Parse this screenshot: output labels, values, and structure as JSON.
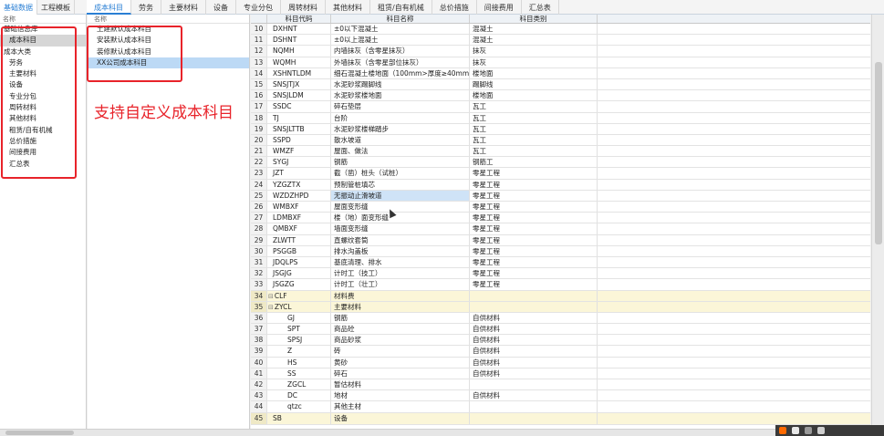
{
  "top_left_tabs": [
    {
      "label": "基础数据",
      "active": true
    },
    {
      "label": "工程模板",
      "active": false
    }
  ],
  "top_main_tabs": [
    {
      "label": "成本科目",
      "active": true
    },
    {
      "label": "劳务",
      "active": false
    },
    {
      "label": "主要材料",
      "active": false
    },
    {
      "label": "设备",
      "active": false
    },
    {
      "label": "专业分包",
      "active": false
    },
    {
      "label": "周转材料",
      "active": false
    },
    {
      "label": "其他材料",
      "active": false
    },
    {
      "label": "租赁/自有机械",
      "active": false
    },
    {
      "label": "总价措施",
      "active": false
    },
    {
      "label": "间接费用",
      "active": false
    },
    {
      "label": "汇总表",
      "active": false
    }
  ],
  "left_panel": {
    "header": "名称",
    "items": [
      {
        "label": "基础信息库",
        "level": 0,
        "selected": false
      },
      {
        "label": "成本科目",
        "level": 1,
        "selected": true
      },
      {
        "label": "成本大类",
        "level": 0,
        "selected": false
      },
      {
        "label": "劳务",
        "level": 1,
        "selected": false
      },
      {
        "label": "主要材料",
        "level": 1,
        "selected": false
      },
      {
        "label": "设备",
        "level": 1,
        "selected": false
      },
      {
        "label": "专业分包",
        "level": 1,
        "selected": false
      },
      {
        "label": "周转材料",
        "level": 1,
        "selected": false
      },
      {
        "label": "其他材料",
        "level": 1,
        "selected": false
      },
      {
        "label": "租赁/自有机械",
        "level": 1,
        "selected": false
      },
      {
        "label": "总价措施",
        "level": 1,
        "selected": false
      },
      {
        "label": "间接费用",
        "level": 1,
        "selected": false
      },
      {
        "label": "汇总表",
        "level": 1,
        "selected": false
      }
    ]
  },
  "mid_panel": {
    "header": "名称",
    "items": [
      {
        "label": "土建默认成本科目",
        "selected": false
      },
      {
        "label": "安装默认成本科目",
        "selected": false
      },
      {
        "label": "装修默认成本科目",
        "selected": false
      },
      {
        "label": "XX公司成本科目",
        "selected": true
      }
    ]
  },
  "annotation": "支持自定义成本科目",
  "table": {
    "columns": [
      "科目代码",
      "科目名称",
      "科目类别"
    ],
    "rows": [
      {
        "num": "10",
        "code": "DXHNT",
        "name": "±0以下混凝土",
        "cat": "混凝土"
      },
      {
        "num": "11",
        "code": "DSHNT",
        "name": "±0以上混凝土",
        "cat": "混凝土"
      },
      {
        "num": "12",
        "code": "NQMH",
        "name": "内墙抹灰（含零星抹灰）",
        "cat": "抹灰"
      },
      {
        "num": "13",
        "code": "WQMH",
        "name": "外墙抹灰（含零星部位抹灰）",
        "cat": "抹灰"
      },
      {
        "num": "14",
        "code": "XSHNTLDM",
        "name": "细石混凝土楼地面（100mm>厚度≥40mm",
        "cat": "楼地面"
      },
      {
        "num": "15",
        "code": "SNSJTJX",
        "name": "水泥砂浆踢脚线",
        "cat": "踢脚线"
      },
      {
        "num": "16",
        "code": "SNSJLDM",
        "name": "水泥砂浆楼地面",
        "cat": "楼地面"
      },
      {
        "num": "17",
        "code": "SSDC",
        "name": "碎石垫层",
        "cat": "瓦工"
      },
      {
        "num": "18",
        "code": "TJ",
        "name": "台阶",
        "cat": "瓦工"
      },
      {
        "num": "19",
        "code": "SNSJLTTB",
        "name": "水泥砂浆楼梯踏步",
        "cat": "瓦工"
      },
      {
        "num": "20",
        "code": "SSPD",
        "name": "散水坡道",
        "cat": "瓦工"
      },
      {
        "num": "21",
        "code": "WMZF",
        "name": "屋面、做法",
        "cat": "瓦工"
      },
      {
        "num": "22",
        "code": "SYGJ",
        "name": "钢筋",
        "cat": "钢筋工"
      },
      {
        "num": "23",
        "code": "JZT",
        "name": "截（凿）桩头（试桩）",
        "cat": "零星工程"
      },
      {
        "num": "24",
        "code": "YZGZTX",
        "name": "预制管桩填芯",
        "cat": "零星工程"
      },
      {
        "num": "25",
        "code": "WZDZHPD",
        "name": "无振动止滑坡道",
        "cat": "零星工程",
        "highlight": true
      },
      {
        "num": "26",
        "code": "WMBXF",
        "name": "屋面变形缝",
        "cat": "零星工程"
      },
      {
        "num": "27",
        "code": "LDMBXF",
        "name": "楼（地）面变形缝",
        "cat": "零星工程"
      },
      {
        "num": "28",
        "code": "QMBXF",
        "name": "墙面变形缝",
        "cat": "零星工程"
      },
      {
        "num": "29",
        "code": "ZLWTT",
        "name": "直螺纹套筒",
        "cat": "零星工程"
      },
      {
        "num": "30",
        "code": "PSGGB",
        "name": "排水沟盖板",
        "cat": "零星工程"
      },
      {
        "num": "31",
        "code": "JDQLPS",
        "name": "基底清理、排水",
        "cat": "零星工程"
      },
      {
        "num": "32",
        "code": "JSGJG",
        "name": "计时工（技工）",
        "cat": "零星工程"
      },
      {
        "num": "33",
        "code": "JSGZG",
        "name": "计时工（壮工）",
        "cat": "零星工程"
      },
      {
        "num": "34",
        "code": "CLF",
        "name": "材料费",
        "cat": "",
        "group": true,
        "expander": "⊟"
      },
      {
        "num": "35",
        "code": "ZYCL",
        "name": "主要材料",
        "cat": "",
        "group": true,
        "expander": "⊟"
      },
      {
        "num": "36",
        "code": "GJ",
        "name": "钢筋",
        "cat": "自供材料",
        "indent": 2
      },
      {
        "num": "37",
        "code": "SPT",
        "name": "商品砼",
        "cat": "自供材料",
        "indent": 2
      },
      {
        "num": "38",
        "code": "SPSJ",
        "name": "商品砂浆",
        "cat": "自供材料",
        "indent": 2
      },
      {
        "num": "39",
        "code": "Z",
        "name": "砖",
        "cat": "自供材料",
        "indent": 2
      },
      {
        "num": "40",
        "code": "HS",
        "name": "黄砂",
        "cat": "自供材料",
        "indent": 2
      },
      {
        "num": "41",
        "code": "SS",
        "name": "碎石",
        "cat": "自供材料",
        "indent": 2
      },
      {
        "num": "42",
        "code": "ZGCL",
        "name": "暂估材料",
        "cat": "",
        "indent": 2
      },
      {
        "num": "43",
        "code": "DC",
        "name": "地材",
        "cat": "自供材料",
        "indent": 2
      },
      {
        "num": "44",
        "code": "qtzc",
        "name": "其他主材",
        "cat": "",
        "indent": 2
      },
      {
        "num": "45",
        "code": "SB",
        "name": "设备",
        "cat": "",
        "group": true
      }
    ]
  }
}
